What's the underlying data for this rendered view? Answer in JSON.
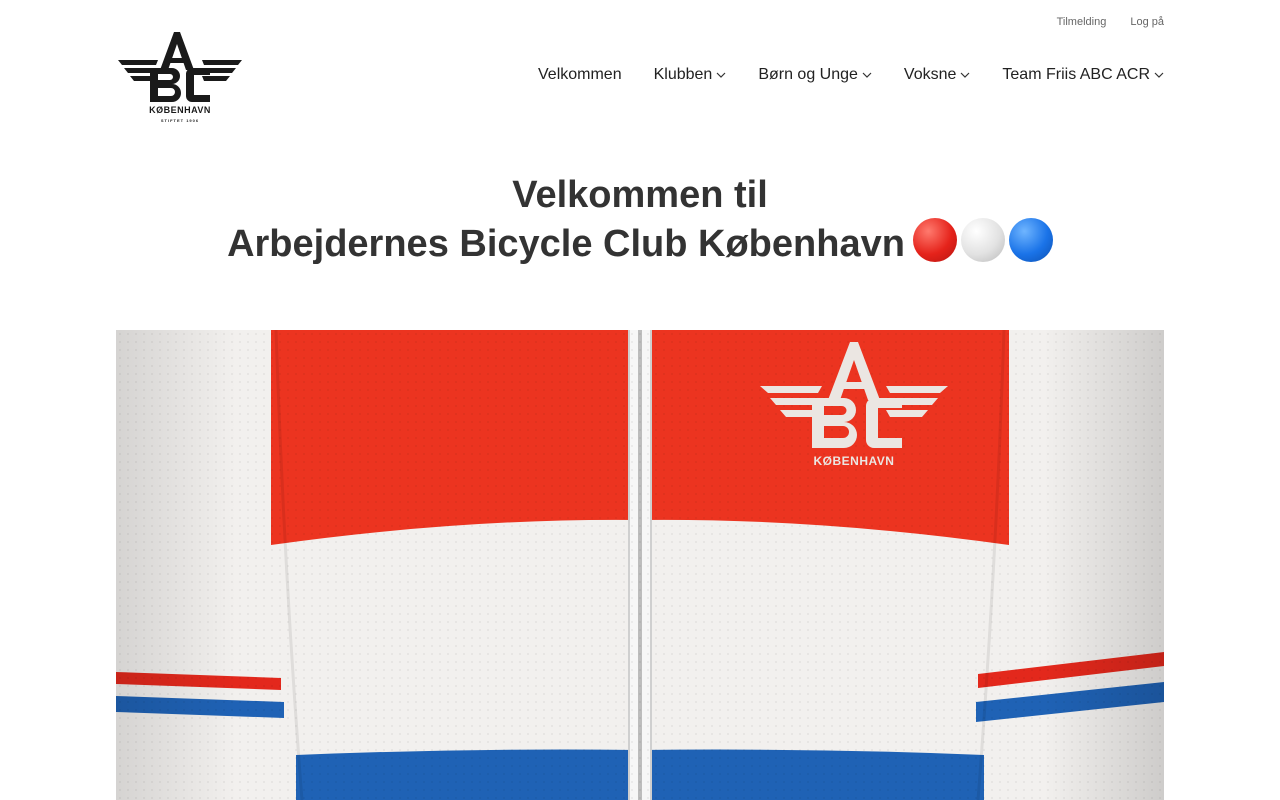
{
  "utility_nav": [
    {
      "label": "Tilmelding"
    },
    {
      "label": "Log på"
    }
  ],
  "logo": {
    "letters": "ABC",
    "city": "KØBENHAVN",
    "founded": "STIFTET 1906"
  },
  "main_nav": [
    {
      "label": "Velkommen",
      "has_dropdown": false
    },
    {
      "label": "Klubben",
      "has_dropdown": true
    },
    {
      "label": "Børn og Unge",
      "has_dropdown": true
    },
    {
      "label": "Voksne",
      "has_dropdown": true
    },
    {
      "label": "Team Friis ABC ACR",
      "has_dropdown": true
    }
  ],
  "hero": {
    "title_line1": "Velkommen til",
    "title_line2": "Arbejdernes Bicycle Club København",
    "emoji": [
      "red-circle",
      "white-circle",
      "blue-circle"
    ]
  },
  "jersey": {
    "logo_city": "KØBENHAVN",
    "colors": {
      "red": "#ec3420",
      "white": "#f2f0ee",
      "blue": "#1f62b5"
    }
  }
}
